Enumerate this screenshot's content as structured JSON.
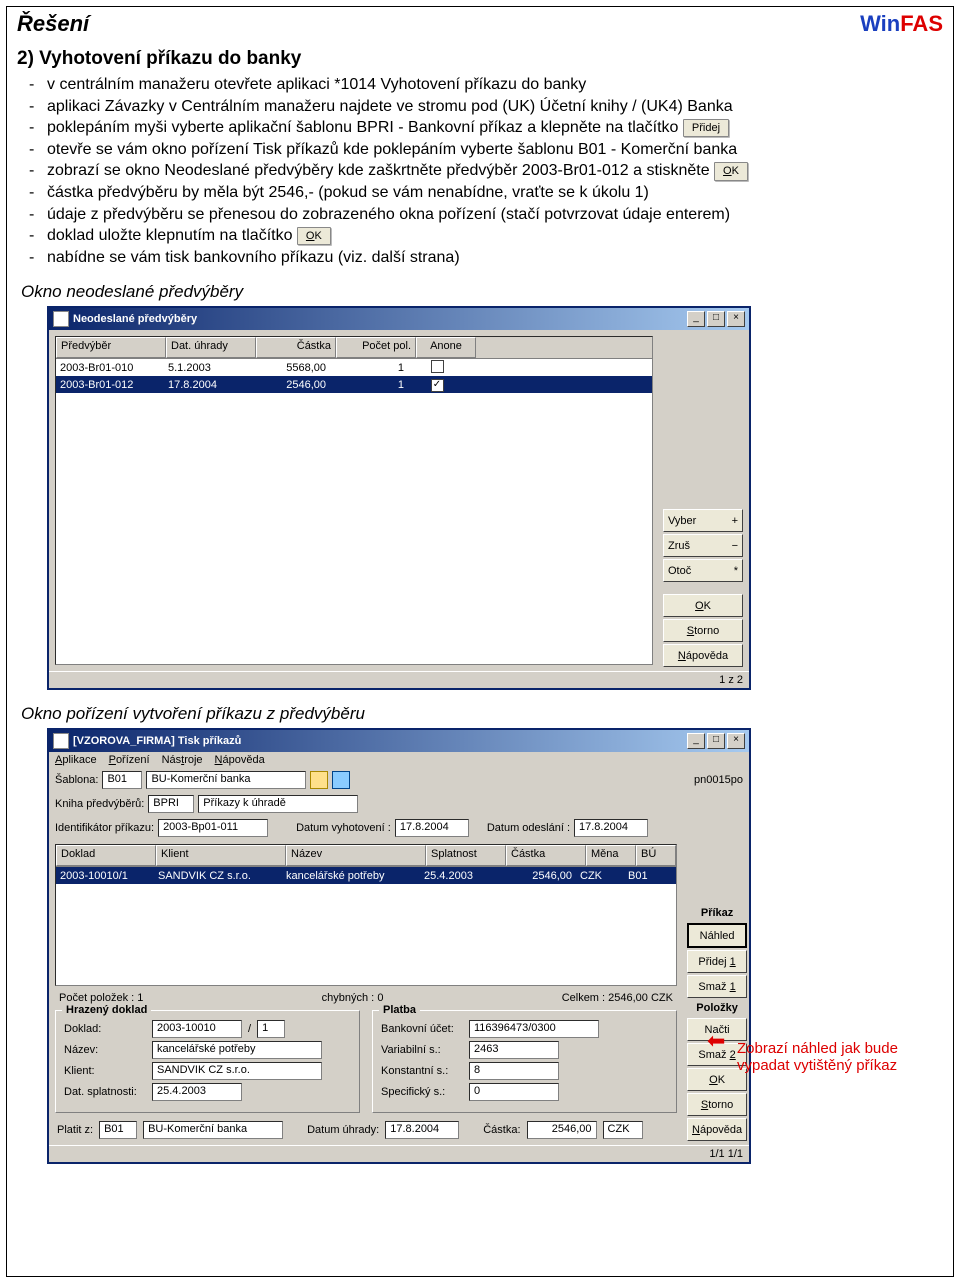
{
  "pageHeader": {
    "title": "Řešení",
    "brandWin": "Win",
    "brandFas": "FAS"
  },
  "sectionTitle": "2) Vyhotovení příkazu do banky",
  "steps": {
    "s1": "v centrálním manažeru otevřete aplikaci *1014 Vyhotovení příkazu do banky",
    "s2": "aplikaci Závazky v Centrálním manažeru najdete ve stromu pod (UK) Účetní knihy / (UK4) Banka",
    "s3a": "poklepáním myši vyberte aplikační šablonu BPRI - Bankovní příkaz a klepněte na tlačítko ",
    "s3btn": "Přidej",
    "s4": "otevře se vám okno pořízení Tisk příkazů kde poklepáním vyberte šablonu B01 - Komerční banka",
    "s5a": "zobrazí se okno Neodeslané předvýběry kde zaškrtněte předvýběr 2003-Br01-012 a stiskněte ",
    "s5btn": "OK",
    "s6": "částka předvýběru by měla být 2546,- (pokud se vám nenabídne, vraťte se k úkolu 1)",
    "s7": "údaje z předvýběru se přenesou do zobrazeného okna pořízení (stačí potvrzovat údaje enterem)",
    "s8a": "doklad uložte klepnutím na tlačítko ",
    "s8btn": "OK",
    "s9": "nabídne se vám tisk bankovního příkazu (viz. další strana)"
  },
  "caption1": "Okno neodeslané předvýběry",
  "win1": {
    "title": "Neodeslané předvýběry",
    "headers": {
      "c1": "Předvýběr",
      "c2": "Dat. úhrady",
      "c3": "Částka",
      "c4": "Počet pol.",
      "c5": "Anone"
    },
    "rows": [
      {
        "c1": "2003-Br01-010",
        "c2": "5.1.2003",
        "c3": "5568,00",
        "c4": "1",
        "checked": false
      },
      {
        "c1": "2003-Br01-012",
        "c2": "17.8.2004",
        "c3": "2546,00",
        "c4": "1",
        "checked": true
      }
    ],
    "btns": {
      "vyber": "Vyber",
      "zrus": "Zruš",
      "otoc": "Otoč",
      "ok": "OK",
      "storno": "Storno",
      "nap": "Nápověda",
      "plus": "+",
      "minus": "−",
      "star": "*"
    },
    "status": "1 z 2"
  },
  "caption2": "Okno pořízení vytvoření příkazu z předvýběru",
  "win2": {
    "title": "[VZOROVA_FIRMA] Tisk příkazů",
    "menu": {
      "m1": "Aplikace",
      "m2": "Pořízení",
      "m3": "Nástroje",
      "m4": "Nápověda"
    },
    "corner": "pn0015po",
    "row1": {
      "l1": "Šablona:",
      "v1": "B01",
      "v1b": "BU-Komerční banka"
    },
    "row2": {
      "l1": "Kniha předvýběrů:",
      "v1": "BPRI",
      "v1b": "Příkazy k úhradě"
    },
    "row3": {
      "l1": "Identifikátor příkazu:",
      "v1": "2003-Bp01-011",
      "l2": "Datum vyhotovení :",
      "v2": "17.8.2004",
      "l3": "Datum odeslání :",
      "v3": "17.8.2004"
    },
    "g2h": {
      "c1": "Doklad",
      "c2": "Klient",
      "c3": "Název",
      "c4": "Splatnost",
      "c5": "Částka",
      "c6": "Měna",
      "c7": "BÚ"
    },
    "g2r": {
      "c1": "2003-10010/1",
      "c2": "SANDVIK CZ s.r.o.",
      "c3": "kancelářské potřeby",
      "c4": "25.4.2003",
      "c5": "2546,00",
      "c6": "CZK",
      "c7": "B01"
    },
    "summary": {
      "l1": "Počet položek :",
      "v1": "1",
      "l2": "chybných :",
      "v2": "0",
      "l3": "Celkem :",
      "v3": "2546,00 CZK"
    },
    "fsHrazeny": {
      "legend": "Hrazený doklad",
      "doklad_l": "Doklad:",
      "doklad_v": "2003-10010",
      "doklad_sub": "/1",
      "nazev_l": "Název:",
      "nazev_v": "kancelářské potřeby",
      "klient_l": "Klient:",
      "klient_v": "SANDVIK CZ s.r.o.",
      "dat_l": "Dat. splatnosti:",
      "dat_v": "25.4.2003"
    },
    "fsPlatba": {
      "legend": "Platba",
      "bu_l": "Bankovní účet:",
      "bu_v": "116396473/0300",
      "vs_l": "Variabilní s.:",
      "vs_v": "2463",
      "ks_l": "Konstantní s.:",
      "ks_v": "8",
      "ss_l": "Specifický s.:",
      "ss_v": "0"
    },
    "bottom": {
      "l1": "Platit z:",
      "v1": "B01",
      "v1b": "BU-Komerční banka",
      "l2": "Datum úhrady:",
      "v2": "17.8.2004",
      "l3": "Částka:",
      "v3": "2546,00",
      "v4": "CZK"
    },
    "sideGroup1": "Příkaz",
    "btn_nahled": "Náhled",
    "btn_pridej1": "Přidej 1",
    "btn_smaz1": "Smaž 1",
    "sideGroup2": "Položky",
    "btn_nacti": "Načti",
    "btn_smaz2": "Smaž 2",
    "btn_ok": "OK",
    "btn_storno": "Storno",
    "btn_nap": "Nápověda",
    "status": "1/1 1/1"
  },
  "callout": {
    "l1": "Zobrazí náhled jak bude",
    "l2": "vypadat vytištěný příkaz"
  }
}
